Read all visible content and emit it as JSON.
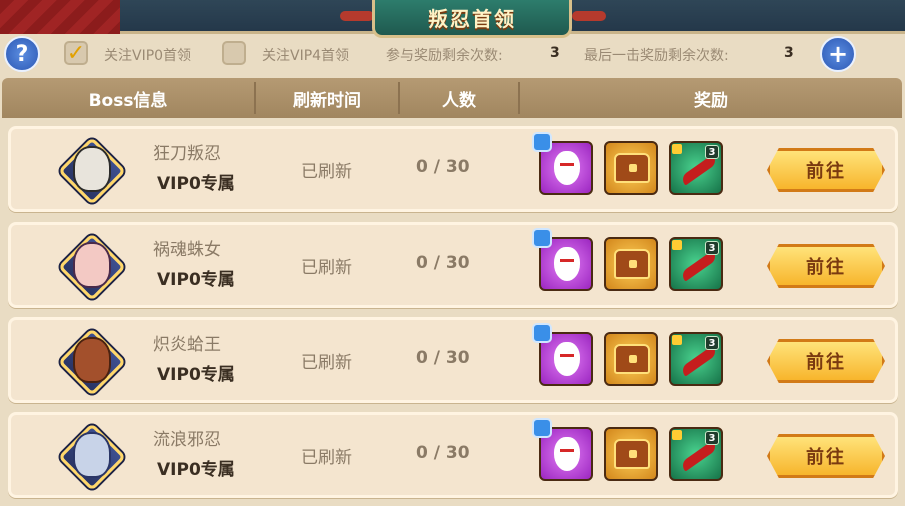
{
  "title": "叛忍首领",
  "status": {
    "help_label": "?",
    "follow_vip0": "关注VIP0首领",
    "follow_vip0_checked": true,
    "follow_vip4": "关注VIP4首领",
    "follow_vip4_checked": false,
    "join_reward_label": "参与奖励剩余次数:",
    "join_reward_count": "3",
    "last_hit_label": "最后一击奖励剩余次数:",
    "last_hit_count": "3",
    "plus_label": "+"
  },
  "columns": [
    "Boss信息",
    "刷新时间",
    "人数",
    "奖励"
  ],
  "rows": [
    {
      "name": "狂刀叛忍",
      "tier": "VIP0专属",
      "refresh": "已刷新",
      "people": "0 / 30",
      "reward_badge": "3",
      "go": "前往",
      "face_color": "#e8e4dc"
    },
    {
      "name": "祸魂蛛女",
      "tier": "VIP0专属",
      "refresh": "已刷新",
      "people": "0 / 30",
      "reward_badge": "3",
      "go": "前往",
      "face_color": "#f3c9c4"
    },
    {
      "name": "炽炎蛤王",
      "tier": "VIP0专属",
      "refresh": "已刷新",
      "people": "0 / 30",
      "reward_badge": "3",
      "go": "前往",
      "face_color": "#a3502c"
    },
    {
      "name": "流浪邪忍",
      "tier": "VIP0专属",
      "refresh": "已刷新",
      "people": "0 / 30",
      "reward_badge": "3",
      "go": "前往",
      "face_color": "#c8d3e8"
    }
  ]
}
